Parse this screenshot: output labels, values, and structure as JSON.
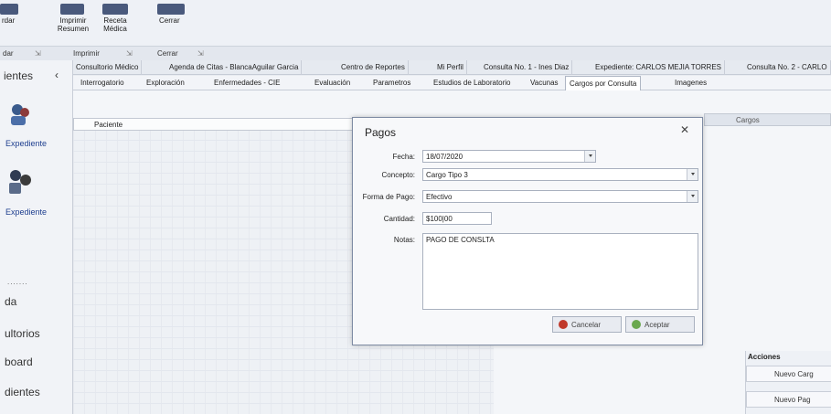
{
  "ribbon": {
    "buttons": [
      {
        "label": "rdar"
      },
      {
        "label": "Imprimir Resumen"
      },
      {
        "label": "Receta Médica"
      },
      {
        "label": "Cerrar"
      }
    ],
    "groups": [
      {
        "label": "dar"
      },
      {
        "label": "Imprimir"
      },
      {
        "label": "Cerrar"
      }
    ]
  },
  "leftnav": {
    "header": "ientes",
    "items": [
      {
        "label": "Expediente"
      },
      {
        "label": "Expediente"
      }
    ],
    "links": [
      "da",
      "ultorios",
      "board",
      "dientes"
    ]
  },
  "tabs": [
    {
      "label": "Consultorio Médico"
    },
    {
      "label": "Agenda de Citas - BlancaAguilar Garcia"
    },
    {
      "label": "Centro de Reportes"
    },
    {
      "label": "Mi Perfil"
    },
    {
      "label": "Consulta No. 1 - Ines Diaz"
    },
    {
      "label": "Expediente: CARLOS MEJIA TORRES"
    },
    {
      "label": "Consulta No. 2 - CARLO"
    }
  ],
  "subtabs": [
    {
      "label": "Interrogatorio"
    },
    {
      "label": "Exploración"
    },
    {
      "label": "Enfermedades - CIE"
    },
    {
      "label": "Evaluación"
    },
    {
      "label": "Parametros"
    },
    {
      "label": "Estudios de Laboratorio"
    },
    {
      "label": "Vacunas"
    },
    {
      "label": "Cargos por Consulta"
    },
    {
      "label": "Imagenes"
    }
  ],
  "grid": {
    "header": "Paciente"
  },
  "right_panel": {
    "header": "Cargos"
  },
  "acciones": {
    "title": "Acciones",
    "buttons": [
      "Nuevo Carg",
      "Nuevo Pag"
    ]
  },
  "dialog": {
    "title": "Pagos",
    "fecha": {
      "label": "Fecha:",
      "value": "18/07/2020"
    },
    "concepto": {
      "label": "Concepto:",
      "value": "Cargo Tipo 3"
    },
    "forma_pago": {
      "label": "Forma de Pago:",
      "value": "Efectivo"
    },
    "cantidad": {
      "label": "Cantidad:",
      "value": "$100|00"
    },
    "notas": {
      "label": "Notas:",
      "value": "PAGO DE CONSLTA"
    },
    "cancel_label": "Cancelar",
    "accept_label": "Aceptar"
  },
  "colors": {
    "cancel_icon": "#c0392b",
    "accept_icon": "#6aa84f"
  }
}
